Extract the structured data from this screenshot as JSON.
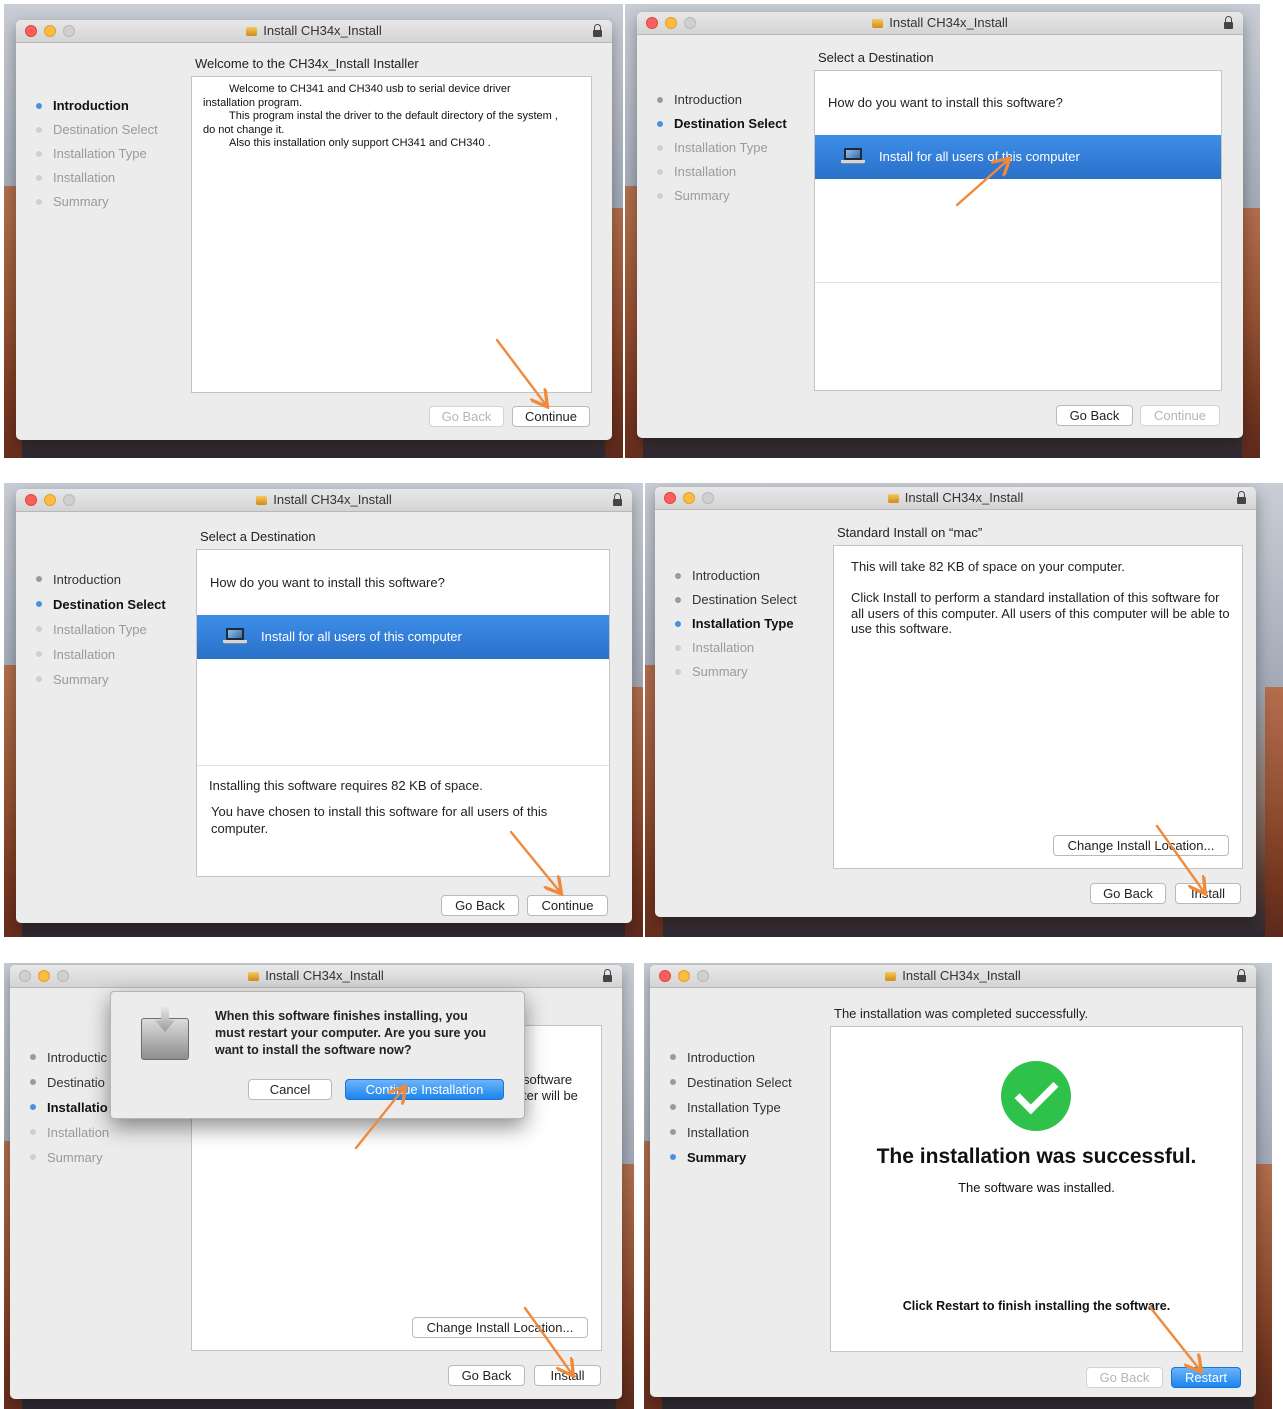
{
  "window": {
    "title": "Install CH34x_Install"
  },
  "steps": [
    "Introduction",
    "Destination Select",
    "Installation Type",
    "Installation",
    "Summary"
  ],
  "buttons": {
    "go_back": "Go Back",
    "continue": "Continue",
    "install": "Install",
    "change_location": "Change Install Location...",
    "restart": "Restart",
    "cancel": "Cancel",
    "continue_installation": "Continue Installation"
  },
  "intro": {
    "heading": "Welcome to the CH34x_Install Installer",
    "line1": "Welcome to CH341 and CH340 usb to serial device driver",
    "line1b": "installation program.",
    "line2": "This program instal the driver to the default directory of the system ,",
    "line2b": "do not change it.",
    "line3": "Also this installation only support CH341 and CH340 ."
  },
  "destination": {
    "heading": "Select a Destination",
    "question": "How do you want to install this software?",
    "option": "Install for all users of this computer",
    "space": "Installing this software requires 82 KB of space.",
    "chosen": "You have chosen to install this software for all users of this computer."
  },
  "install_type": {
    "heading": "Standard Install on “mac”",
    "space": "This will take 82 KB of space on your computer.",
    "description": "Click Install to perform a standard installation of this software for all users of this computer. All users of this computer will be able to use this software.",
    "partial1": "software",
    "partial2": "ter will be",
    "truncated_steps": [
      "Introductic",
      "Destinatio",
      "Installatio"
    ]
  },
  "dialog": {
    "message": "When this software finishes installing, you must restart your computer. Are you sure you want to install the software now?"
  },
  "summary": {
    "heading": "The installation was completed successfully.",
    "big": "The installation was successful.",
    "sub": "The software was installed.",
    "footer": "Click Restart to finish installing the software."
  },
  "colors": {
    "accent": "#2a7be4",
    "annotation_arrow": "#f08a3a",
    "success": "#2fc24a"
  }
}
